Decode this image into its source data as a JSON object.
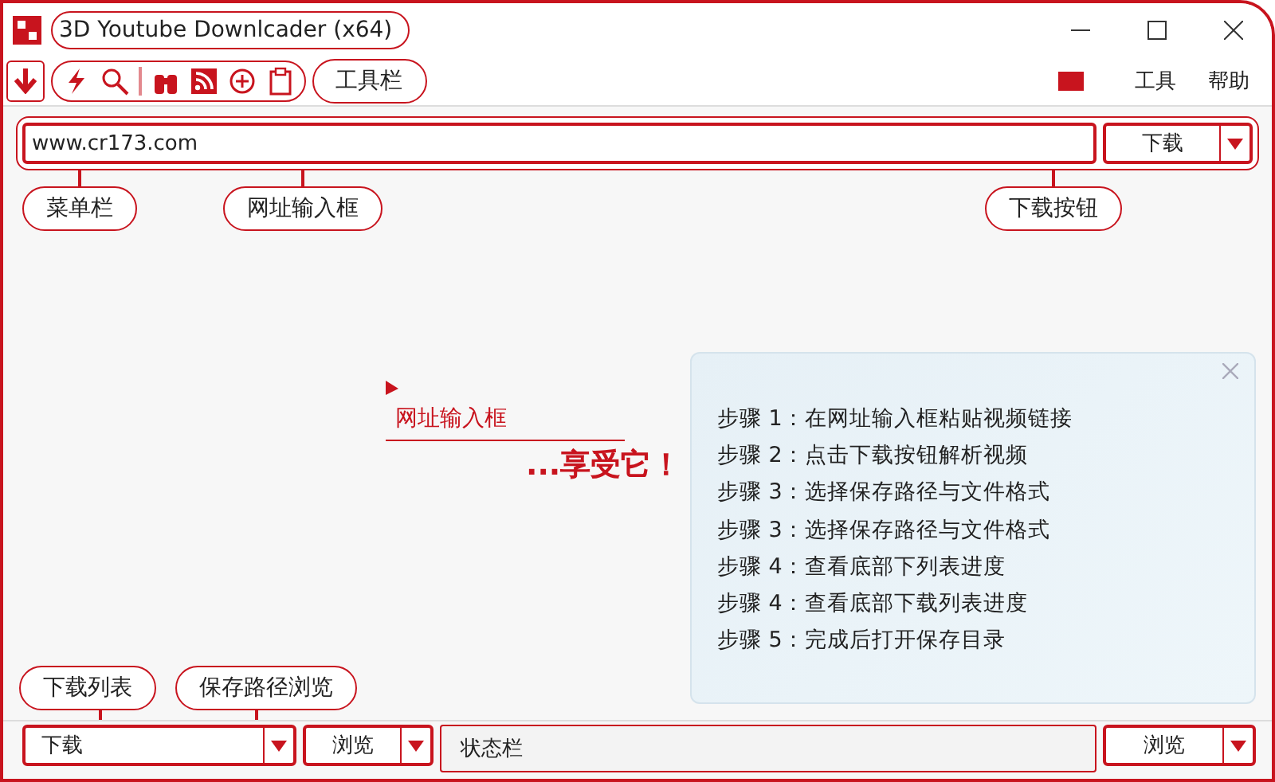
{
  "window": {
    "title": "3D Youtube Downlcader (x64)"
  },
  "toolbar": {
    "callout": "工具栏",
    "menu": [
      "工具",
      "帮助"
    ]
  },
  "url_bar": {
    "value": "www.cr173.com",
    "button": "下载"
  },
  "top_callouts": [
    "菜单栏",
    "网址输入框",
    "下载按钮"
  ],
  "guide": {
    "annotation": "网址输入框",
    "slogan": "...享受它！",
    "steps": [
      "步骤 1：在网址输入框粘贴视频链接",
      "步骤 2：点击下载按钮解析视频",
      "步骤 3：选择保存路径与文件格式",
      "步骤 3：选择保存路径与文件格式",
      "步骤 4：查看底部下列表进度",
      "步骤 4：查看底部下载列表进度",
      "步骤 5：完成后打开保存目录"
    ]
  },
  "bottom_callouts": [
    "下载列表",
    "保存路径浏览"
  ],
  "bottom_bar": {
    "list": "下载",
    "browse": "浏览",
    "status": "状态栏",
    "browse_right": "浏览"
  }
}
